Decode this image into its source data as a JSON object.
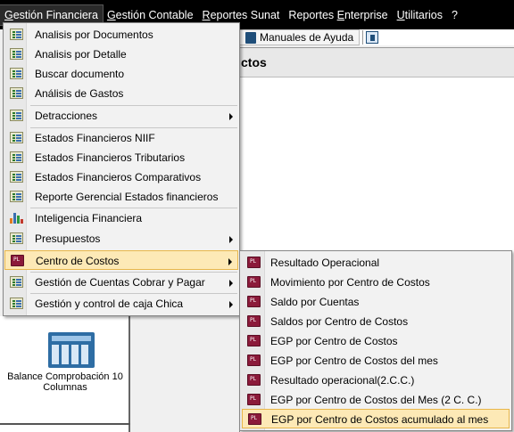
{
  "menubar": {
    "items": [
      {
        "pre": "",
        "ul": "G",
        "post": "estión Financiera"
      },
      {
        "pre": "",
        "ul": "G",
        "post": "estión Contable"
      },
      {
        "pre": "",
        "ul": "R",
        "post": "eportes Sunat"
      },
      {
        "pre": "Reportes ",
        "ul": "E",
        "post": "nterprise"
      },
      {
        "pre": "",
        "ul": "U",
        "post": "tilitarios"
      },
      {
        "pre": "?",
        "ul": "",
        "post": ""
      }
    ]
  },
  "toolbar": {
    "manuals_label": "Manuales de Ayuda"
  },
  "panel": {
    "title_fragment": "ctos"
  },
  "left_strip": {
    "tile_label": "Balance Comprobación 10 Columnas"
  },
  "menu": {
    "items": [
      {
        "label": "Analisis por Documentos",
        "icon": "list-icon"
      },
      {
        "label": "Analisis por Detalle",
        "icon": "list-icon"
      },
      {
        "label": "Buscar documento",
        "icon": "list-icon"
      },
      {
        "label": "Análisis de Gastos",
        "icon": "list-icon"
      },
      {
        "label": "Detracciones",
        "icon": "list-icon"
      },
      {
        "label": "Estados Financieros NIIF",
        "icon": "list-icon"
      },
      {
        "label": "Estados Financieros Tributarios",
        "icon": "list-icon"
      },
      {
        "label": "Estados Financieros Comparativos",
        "icon": "list-icon"
      },
      {
        "label": "Reporte Gerencial Estados financieros",
        "icon": "list-icon"
      },
      {
        "label": "Inteligencia Financiera",
        "icon": "bar-chart-icon"
      },
      {
        "label": "Presupuestos",
        "icon": "list-icon"
      },
      {
        "label": "Centro de Costos",
        "icon": "pl-report-icon"
      },
      {
        "label": "Gestión de Cuentas Cobrar y Pagar",
        "icon": "list-icon"
      },
      {
        "label": "Gestión y control de caja Chica",
        "icon": "list-icon"
      }
    ]
  },
  "submenu": {
    "items": [
      {
        "label": "Resultado Operacional",
        "icon": "pl-report-icon"
      },
      {
        "label": "Movimiento por Centro de Costos",
        "icon": "pl-report-icon"
      },
      {
        "label": "Saldo por Cuentas",
        "icon": "pl-report-icon"
      },
      {
        "label": "Saldos por Centro de Costos",
        "icon": "pl-report-icon"
      },
      {
        "label": "EGP por Centro de Costos",
        "icon": "pl-report-icon"
      },
      {
        "label": "EGP por Centro de Costos del mes",
        "icon": "pl-report-icon"
      },
      {
        "label": "Resultado operacional(2.C.C.)",
        "icon": "pl-report-icon"
      },
      {
        "label": "EGP por Centro de Costos del Mes (2 C. C.)",
        "icon": "pl-report-icon"
      },
      {
        "label": "EGP por Centro de Costos acumulado al mes",
        "icon": "pl-report-icon"
      }
    ]
  },
  "colors": {
    "menubar_bg": "#000000",
    "highlight_bg": "#fde9b6",
    "highlight_border": "#e8b64a",
    "pl_icon": "#8b1a3a"
  }
}
